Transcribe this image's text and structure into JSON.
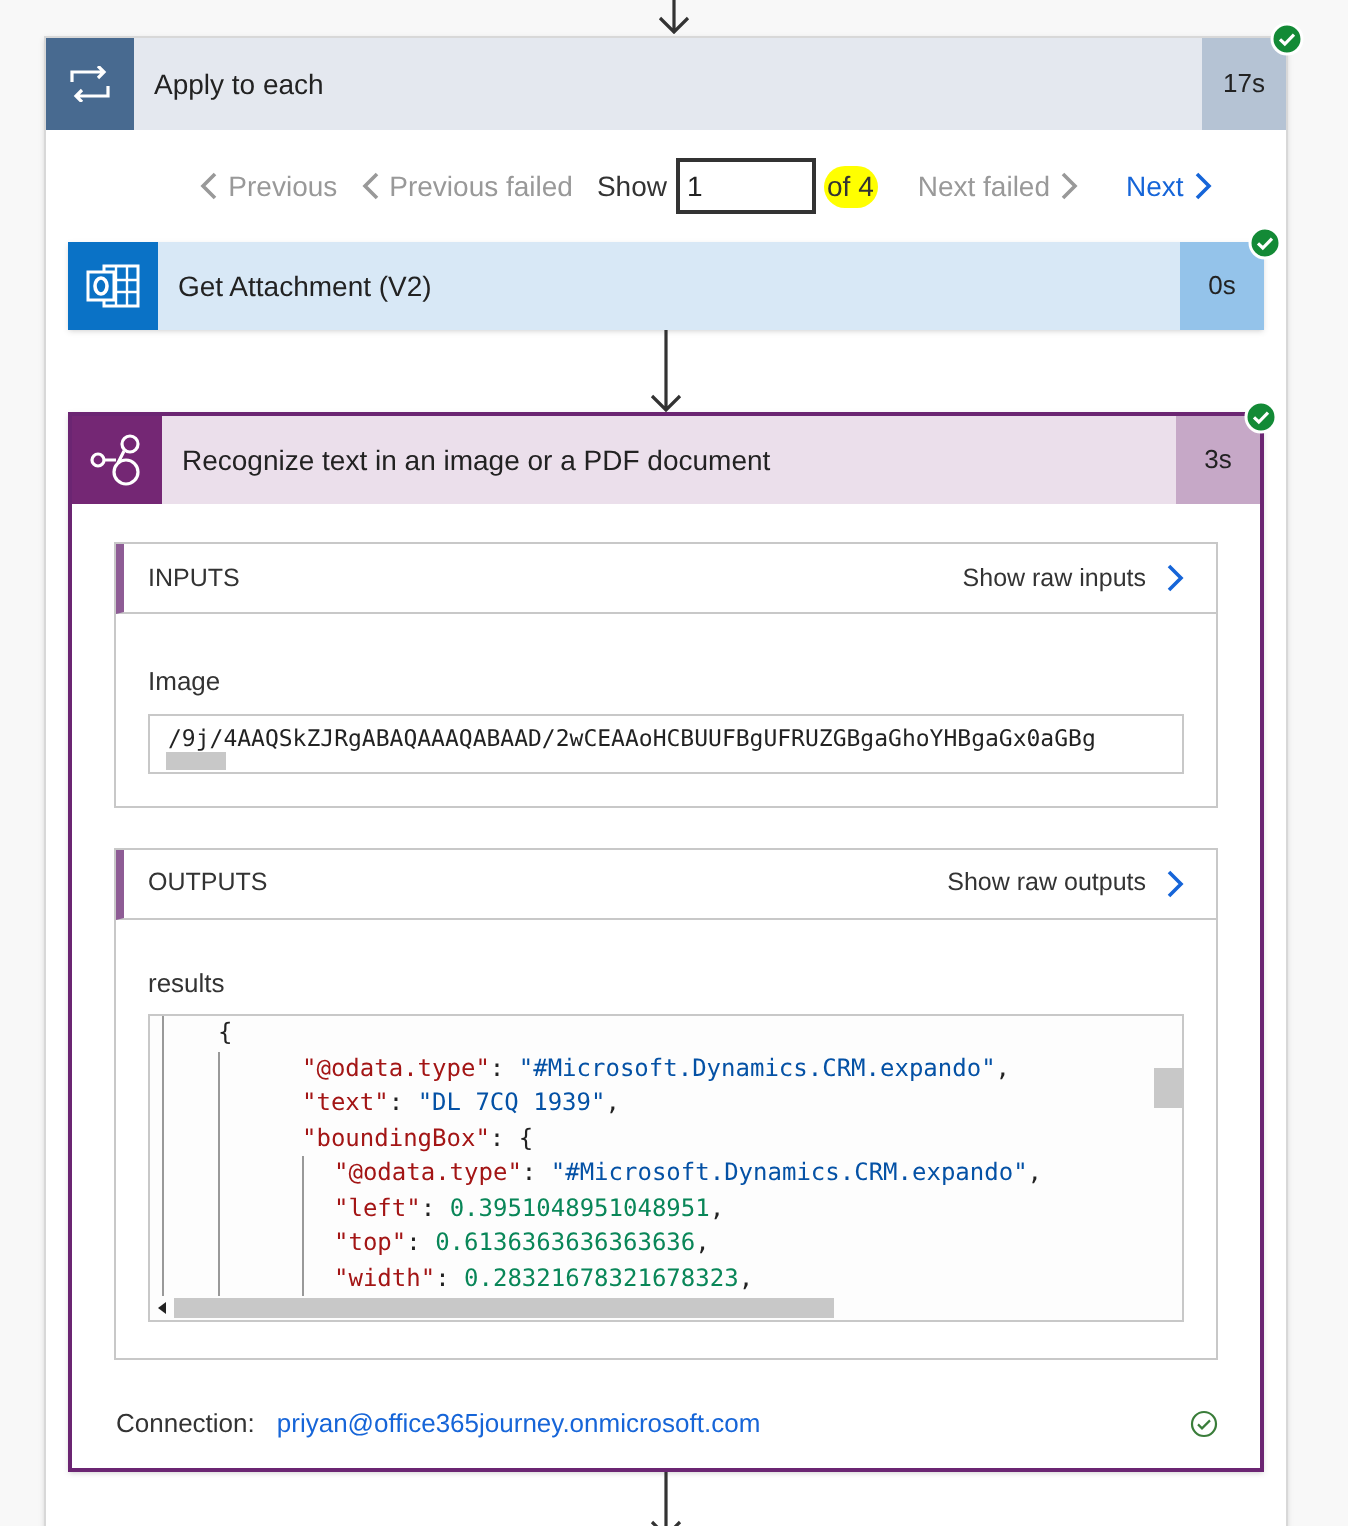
{
  "loop": {
    "title": "Apply to each",
    "duration": "17s",
    "succeeded": true,
    "pager": {
      "previous": "Previous",
      "previous_failed": "Previous failed",
      "show_label": "Show",
      "value": "1",
      "of": "of 4",
      "next_failed": "Next failed",
      "next": "Next"
    }
  },
  "actions": [
    {
      "kind": "outlook",
      "title": "Get Attachment (V2)",
      "duration": "0s",
      "succeeded": true
    },
    {
      "kind": "ai",
      "title": "Recognize text in an image or a PDF document",
      "duration": "3s",
      "succeeded": true,
      "expanded": true
    }
  ],
  "inputs": {
    "heading": "INPUTS",
    "raw_link": "Show raw inputs",
    "label": "Image",
    "value": "/9j/4AAQSkZJRgABAQAAAQABAAD/2wCEAAoHCBUUFBgUFRUZGBgaGhoYHBgaGx0aGBg"
  },
  "outputs": {
    "heading": "OUTPUTS",
    "raw_link": "Show raw outputs",
    "label": "results",
    "lines": [
      {
        "tokens": [
          {
            "kind": "punct",
            "text": "{"
          }
        ],
        "children": [
          {
            "tokens": [
              {
                "kind": "key",
                "text": "\"@odata.type\""
              },
              {
                "kind": "punct",
                "text": ": "
              },
              {
                "kind": "string",
                "text": "\"#Microsoft.Dynamics.CRM.expando\""
              },
              {
                "kind": "punct",
                "text": ","
              }
            ]
          },
          {
            "tokens": [
              {
                "kind": "key",
                "text": "\"text\""
              },
              {
                "kind": "punct",
                "text": ": "
              },
              {
                "kind": "string",
                "text": "\"DL 7CQ 1939\""
              },
              {
                "kind": "punct",
                "text": ","
              }
            ]
          },
          {
            "tokens": [
              {
                "kind": "key",
                "text": "\"boundingBox\""
              },
              {
                "kind": "punct",
                "text": ": {"
              }
            ],
            "children": [
              {
                "tokens": [
                  {
                    "kind": "key",
                    "text": "\"@odata.type\""
                  },
                  {
                    "kind": "punct",
                    "text": ": "
                  },
                  {
                    "kind": "string",
                    "text": "\"#Microsoft.Dynamics.CRM.expando\""
                  },
                  {
                    "kind": "punct",
                    "text": ","
                  }
                ]
              },
              {
                "tokens": [
                  {
                    "kind": "key",
                    "text": "\"left\""
                  },
                  {
                    "kind": "punct",
                    "text": ": "
                  },
                  {
                    "kind": "number",
                    "text": "0.3951048951048951"
                  },
                  {
                    "kind": "punct",
                    "text": ","
                  }
                ]
              },
              {
                "tokens": [
                  {
                    "kind": "key",
                    "text": "\"top\""
                  },
                  {
                    "kind": "punct",
                    "text": ": "
                  },
                  {
                    "kind": "number",
                    "text": "0.6136363636363636"
                  },
                  {
                    "kind": "punct",
                    "text": ","
                  }
                ]
              },
              {
                "tokens": [
                  {
                    "kind": "key",
                    "text": "\"width\""
                  },
                  {
                    "kind": "punct",
                    "text": ": "
                  },
                  {
                    "kind": "number",
                    "text": "0.28321678321678323"
                  },
                  {
                    "kind": "punct",
                    "text": ","
                  }
                ]
              }
            ]
          }
        ]
      }
    ]
  },
  "connection": {
    "label": "Connection:",
    "account": "priyan@office365journey.onmicrosoft.com",
    "verified": true
  }
}
